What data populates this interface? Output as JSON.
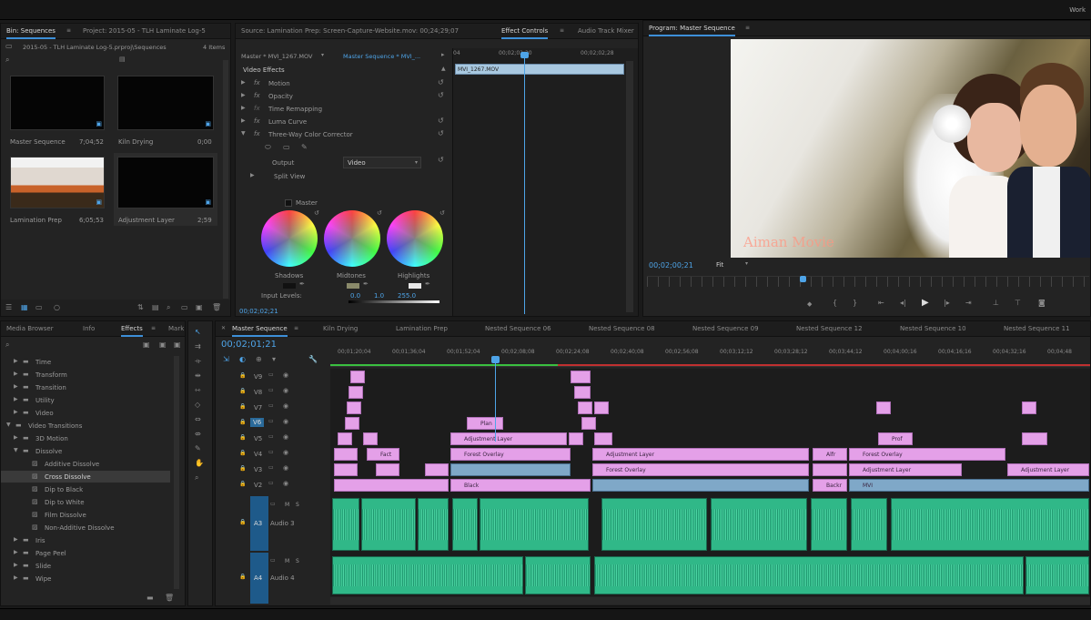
{
  "top_bar": {
    "title": "Work"
  },
  "project_panel": {
    "tabs": [
      "Bin: Sequences",
      "Project: 2015-05 - TLH Laminate Log-5"
    ],
    "path": "2015-05 - TLH Laminate Log-5.prproj\\Sequences",
    "item_count": "4 Items",
    "items": [
      {
        "name": "Master Sequence",
        "duration": "7;04;52"
      },
      {
        "name": "Kiln Drying",
        "duration": "0;00"
      },
      {
        "name": "Lamination Prep",
        "duration": "6;05;53"
      },
      {
        "name": "Adjustment Layer",
        "duration": "2;59"
      }
    ]
  },
  "effect_controls": {
    "tabs": [
      "Source: Lamination Prep: Screen-Capture-Website.mov: 00;24;29;07",
      "Effect Controls",
      "Audio Track Mixer"
    ],
    "master_clip": "Master * MVI_1267.MOV",
    "sequence_clip": "Master Sequence * MVI_...",
    "section": "Video Effects",
    "effects": [
      "Motion",
      "Opacity",
      "Time Remapping",
      "Luma Curve",
      "Three-Way Color Corrector"
    ],
    "output_label": "Output",
    "output_value": "Video",
    "split_view": "Split View",
    "master_label": "Master",
    "wheels": [
      "Shadows",
      "Midtones",
      "Highlights"
    ],
    "input_levels_label": "Input Levels:",
    "input_levels": [
      "0.0",
      "1.0",
      "255.0"
    ],
    "timecode": "00;02;02;21",
    "ruler": [
      "04",
      "00;02;02;20",
      "00;02;02;28"
    ],
    "clip_name": "MVI_1267.MOV"
  },
  "program_monitor": {
    "title": "Program: Master Sequence",
    "timecode": "00;02;00;21",
    "fit": "Fit",
    "watermark": "Aiman Movie"
  },
  "effects_panel": {
    "tabs": [
      "Media Browser",
      "Info",
      "Effects",
      "Mark"
    ],
    "tree": [
      {
        "label": "Time",
        "indent": 1,
        "type": "folder"
      },
      {
        "label": "Transform",
        "indent": 1,
        "type": "folder"
      },
      {
        "label": "Transition",
        "indent": 1,
        "type": "folder"
      },
      {
        "label": "Utility",
        "indent": 1,
        "type": "folder"
      },
      {
        "label": "Video",
        "indent": 1,
        "type": "folder"
      },
      {
        "label": "Video Transitions",
        "indent": 0,
        "type": "folder-open"
      },
      {
        "label": "3D Motion",
        "indent": 1,
        "type": "folder"
      },
      {
        "label": "Dissolve",
        "indent": 1,
        "type": "folder-open"
      },
      {
        "label": "Additive Dissolve",
        "indent": 2,
        "type": "item"
      },
      {
        "label": "Cross Dissolve",
        "indent": 2,
        "type": "item-selected"
      },
      {
        "label": "Dip to Black",
        "indent": 2,
        "type": "item"
      },
      {
        "label": "Dip to White",
        "indent": 2,
        "type": "item"
      },
      {
        "label": "Film Dissolve",
        "indent": 2,
        "type": "item"
      },
      {
        "label": "Non-Additive Dissolve",
        "indent": 2,
        "type": "item"
      },
      {
        "label": "Iris",
        "indent": 1,
        "type": "folder"
      },
      {
        "label": "Page Peel",
        "indent": 1,
        "type": "folder"
      },
      {
        "label": "Slide",
        "indent": 1,
        "type": "folder"
      },
      {
        "label": "Wipe",
        "indent": 1,
        "type": "folder"
      }
    ]
  },
  "timeline": {
    "tabs": [
      "Master Sequence",
      "Kiln Drying",
      "Lamination Prep",
      "Nested Sequence 06",
      "Nested Sequence 08",
      "Nested Sequence 09",
      "Nested Sequence 12",
      "Nested Sequence 10",
      "Nested Sequence 11"
    ],
    "timecode": "00;02;01;21",
    "ruler": [
      "00;01;20;04",
      "00;01;36;04",
      "00;01;52;04",
      "00;02;08;08",
      "00;02;24;08",
      "00;02;40;08",
      "00;02;56;08",
      "00;03;12;12",
      "00;03;28;12",
      "00;03;44;12",
      "00;04;00;16",
      "00;04;16;16",
      "00;04;32;16",
      "00;04;48"
    ],
    "video_tracks": [
      "V9",
      "V8",
      "V7",
      "V6",
      "V5",
      "V4",
      "V3",
      "V2"
    ],
    "audio_tracks": [
      {
        "id": "A3",
        "name": "Audio 3"
      },
      {
        "id": "A4",
        "name": "Audio 4"
      }
    ],
    "clip_labels": [
      "Plan",
      "Adjustment Layer",
      "Forest Overlay",
      "Adjustment Layer",
      "Forest Overlay",
      "Black",
      "Fact",
      "Prof",
      "Alfr",
      "Forest Overlay",
      "Adjustment Layer",
      "Adjustment Layer",
      "Adjustment Layer",
      "Backr",
      "MVI"
    ]
  }
}
